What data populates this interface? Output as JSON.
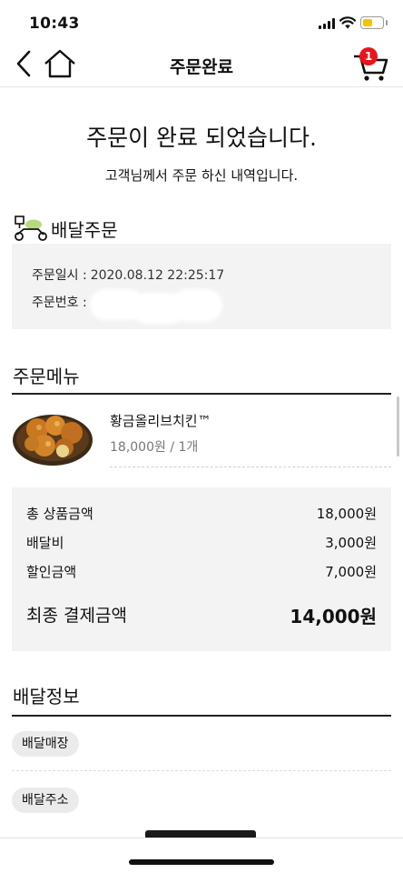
{
  "status_bar": {
    "time": "10:43"
  },
  "header": {
    "title": "주문완료",
    "cart_count": "1"
  },
  "completion": {
    "title": "주문이 완료 되었습니다.",
    "subtitle": "고객님께서 주문 하신 내역입니다."
  },
  "delivery_order": {
    "label": "배달주문",
    "order_date_label": "주문일시 :",
    "order_date_value": "2020.08.12 22:25:17",
    "order_number_label": "주문번호 :",
    "order_number_value": ""
  },
  "order_menu": {
    "title": "주문메뉴",
    "items": [
      {
        "name": "황금올리브치킨™",
        "price_qty": "18,000원 / 1개"
      }
    ]
  },
  "summary": {
    "rows": [
      {
        "label": "총 상품금액",
        "value": "18,000원"
      },
      {
        "label": "배달비",
        "value": "3,000원"
      },
      {
        "label": "할인금액",
        "value": "7,000원"
      }
    ],
    "total_label": "최종 결제금액",
    "total_value": "14,000원"
  },
  "delivery_info": {
    "title": "배달정보",
    "store_label": "배달매장",
    "address_label": "배달주소"
  },
  "colors": {
    "badge": "#e8141d",
    "battery": "#f5c400",
    "panel": "#f3f3f3"
  },
  "icons": [
    "back-arrow-icon",
    "home-icon",
    "cart-icon",
    "delivery-scooter-icon",
    "signal-icon",
    "wifi-icon",
    "battery-icon"
  ]
}
